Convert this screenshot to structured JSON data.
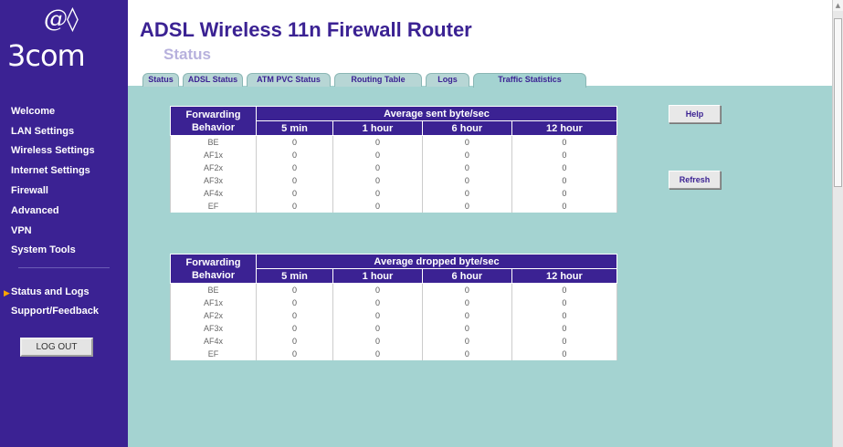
{
  "brand": {
    "logo_mark": "@◊",
    "logo_text": "3com"
  },
  "sidebar": {
    "items": [
      {
        "label": "Welcome"
      },
      {
        "label": "LAN Settings"
      },
      {
        "label": "Wireless Settings"
      },
      {
        "label": "Internet Settings"
      },
      {
        "label": "Firewall"
      },
      {
        "label": "Advanced"
      },
      {
        "label": "VPN"
      },
      {
        "label": "System Tools"
      },
      {
        "label": "Status and Logs"
      },
      {
        "label": "Support/Feedback"
      }
    ],
    "active_item": "Status and Logs",
    "logout_label": "LOG OUT"
  },
  "header": {
    "title": "ADSL Wireless 11n Firewall Router",
    "subtitle": "Status"
  },
  "tabs": [
    {
      "label": "Status"
    },
    {
      "label": "ADSL Status"
    },
    {
      "label": "ATM PVC Status"
    },
    {
      "label": "Routing Table"
    },
    {
      "label": "Logs"
    },
    {
      "label": "Traffic Statistics"
    }
  ],
  "active_tab": "Traffic Statistics",
  "buttons": {
    "help": "Help",
    "refresh": "Refresh"
  },
  "sent_table": {
    "col1_header_line1": "Forwarding",
    "col1_header_line2": "Behavior",
    "group_header": "Average sent byte/sec",
    "columns": [
      "5 min",
      "1 hour",
      "6 hour",
      "12 hour"
    ],
    "rows": [
      {
        "behavior": "BE",
        "values": [
          "0",
          "0",
          "0",
          "0"
        ]
      },
      {
        "behavior": "AF1x",
        "values": [
          "0",
          "0",
          "0",
          "0"
        ]
      },
      {
        "behavior": "AF2x",
        "values": [
          "0",
          "0",
          "0",
          "0"
        ]
      },
      {
        "behavior": "AF3x",
        "values": [
          "0",
          "0",
          "0",
          "0"
        ]
      },
      {
        "behavior": "AF4x",
        "values": [
          "0",
          "0",
          "0",
          "0"
        ]
      },
      {
        "behavior": "EF",
        "values": [
          "0",
          "0",
          "0",
          "0"
        ]
      }
    ]
  },
  "dropped_table": {
    "col1_header_line1": "Forwarding",
    "col1_header_line2": "Behavior",
    "group_header": "Average dropped byte/sec",
    "columns": [
      "5 min",
      "1 hour",
      "6 hour",
      "12 hour"
    ],
    "rows": [
      {
        "behavior": "BE",
        "values": [
          "0",
          "0",
          "0",
          "0"
        ]
      },
      {
        "behavior": "AF1x",
        "values": [
          "0",
          "0",
          "0",
          "0"
        ]
      },
      {
        "behavior": "AF2x",
        "values": [
          "0",
          "0",
          "0",
          "0"
        ]
      },
      {
        "behavior": "AF3x",
        "values": [
          "0",
          "0",
          "0",
          "0"
        ]
      },
      {
        "behavior": "AF4x",
        "values": [
          "0",
          "0",
          "0",
          "0"
        ]
      },
      {
        "behavior": "EF",
        "values": [
          "0",
          "0",
          "0",
          "0"
        ]
      }
    ]
  },
  "colors": {
    "brand_purple": "#3b2293",
    "content_teal": "#a4d3d1",
    "subtitle_lavender": "#b7b1dd",
    "active_arrow": "#ffa500"
  }
}
